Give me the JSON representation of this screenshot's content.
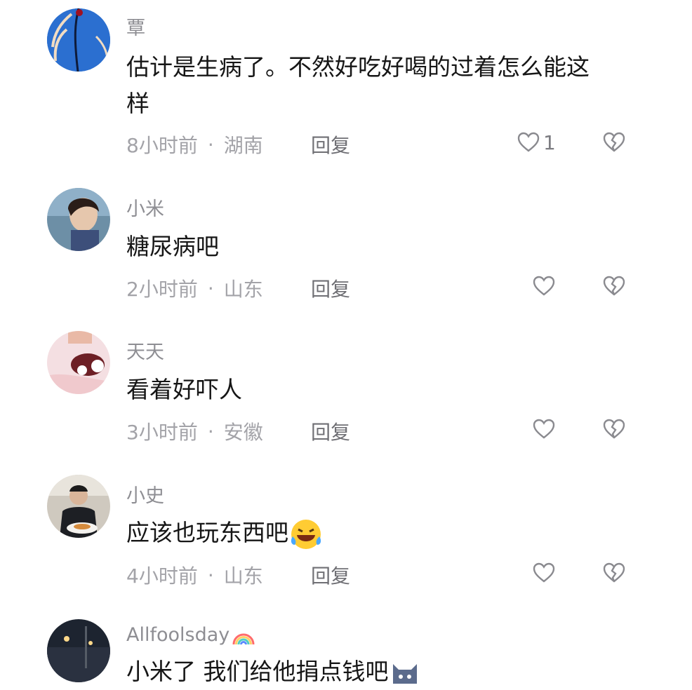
{
  "comments": [
    {
      "username": "覃",
      "content": "估计是生病了。不然好吃好喝的过着怎么能这样",
      "time": "8小时前",
      "location": "湖南",
      "reply_label": "回复",
      "likes": "1",
      "avatar_icon": "blue-feather-avatar"
    },
    {
      "username": "小米",
      "content": "糖尿病吧",
      "time": "2小时前",
      "location": "山东",
      "reply_label": "回复",
      "likes": "",
      "avatar_icon": "girl-portrait-avatar"
    },
    {
      "username": "天天",
      "content": "看着好吓人",
      "time": "3小时前",
      "location": "安徽",
      "reply_label": "回复",
      "likes": "",
      "avatar_icon": "cartoon-avatar"
    },
    {
      "username": "小史",
      "content": "应该也玩东西吧",
      "time": "4小时前",
      "location": "山东",
      "reply_label": "回复",
      "likes": "",
      "avatar_icon": "man-photo-avatar",
      "emoji": "laughing-tears-emoji"
    },
    {
      "username": "Allfoolsday",
      "username_emoji": "rainbow-emoji",
      "content": "小米了 我们给他捐点钱吧",
      "avatar_icon": "night-street-avatar",
      "emoji": "cat-emoji"
    }
  ],
  "separator": "·",
  "colors": {
    "text_primary": "#161616",
    "text_secondary": "#8e8e93",
    "icon_gray": "#8a8a8f"
  }
}
